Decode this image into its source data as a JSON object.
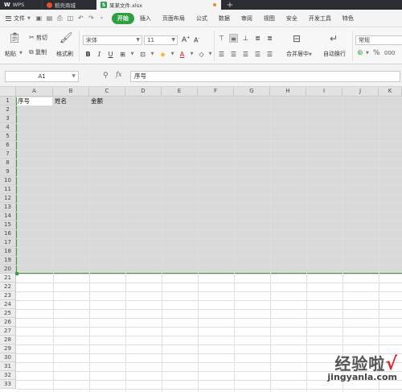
{
  "titlebar": {
    "tabs": [
      {
        "label": "WPS"
      },
      {
        "label": "稻壳商城"
      },
      {
        "label": "某某文件.xlsx"
      }
    ],
    "new_tab": "+"
  },
  "menubar": {
    "file_label": "文件",
    "items": [
      "开始",
      "插入",
      "页面布局",
      "公式",
      "数据",
      "审阅",
      "视图",
      "安全",
      "开发工具",
      "特色"
    ],
    "active": "开始"
  },
  "ribbon": {
    "paste": "粘贴",
    "cut": "剪切",
    "copy": "复制",
    "format_painter": "格式刷",
    "font_name": "宋体",
    "font_size": "11",
    "merge_center": "合并居中",
    "wrap_text": "自动换行",
    "number_format": "常规",
    "accent": "#2ea043"
  },
  "formulabar": {
    "cell_ref": "A1",
    "fx": "fx",
    "content": "序号"
  },
  "sheet": {
    "columns": [
      "A",
      "B",
      "C",
      "D",
      "E",
      "F",
      "G",
      "H",
      "I",
      "J",
      "K"
    ],
    "rows": [
      "1",
      "2",
      "3",
      "4",
      "5",
      "6",
      "7",
      "8",
      "9",
      "10",
      "11",
      "12",
      "13",
      "14",
      "15",
      "16",
      "17",
      "18",
      "19",
      "20",
      "21",
      "22",
      "23",
      "24",
      "25",
      "26",
      "27",
      "28",
      "29",
      "30",
      "31",
      "32",
      "33"
    ],
    "cells": [
      {
        "ref": "A1",
        "value": "序号"
      },
      {
        "ref": "B1",
        "value": "姓名"
      },
      {
        "ref": "C1",
        "value": "金额"
      }
    ],
    "selection_color": "#3a9d3a"
  },
  "watermark": {
    "text": "经验啦",
    "check": "√",
    "url": "jingyanla.com"
  }
}
